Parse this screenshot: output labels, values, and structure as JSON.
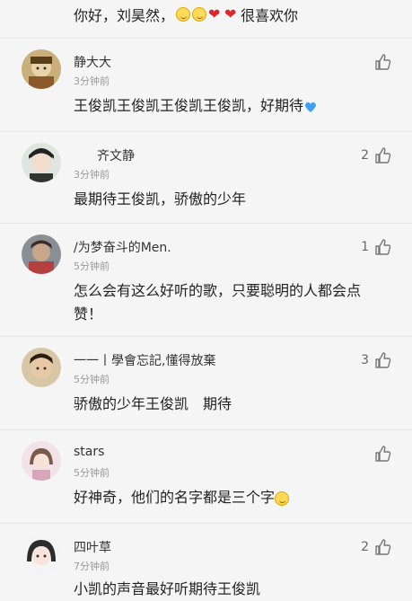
{
  "top": {
    "text_prefix": "你好，刘昊然，",
    "text_suffix": "很喜欢你"
  },
  "comments": [
    {
      "name": "静大大",
      "time": "3分钟前",
      "likes": "",
      "content": "王俊凯王俊凯王俊凯王俊凯，好期待",
      "content_emoji": "blue-heart-icon"
    },
    {
      "name": "齐文静",
      "time": "3分钟前",
      "likes": "2",
      "content": "最期待王俊凯，骄傲的少年"
    },
    {
      "name": "/为梦奋斗的Men.",
      "time": "5分钟前",
      "likes": "1",
      "content": "怎么会有这么好听的歌，只要聪明的人都会点赞！"
    },
    {
      "name": "一一丨學會忘記,懂得放棄",
      "time": "5分钟前",
      "likes": "3",
      "content": "骄傲的少年王俊凯　期待"
    },
    {
      "name": "stars",
      "time": "5分钟前",
      "likes": "",
      "content": "好神奇，他们的名字都是三个字",
      "content_emoji": "laughing-face-icon"
    },
    {
      "name": "四叶草",
      "time": "7分钟前",
      "likes": "2",
      "content": "小凯的声音最好听期待王俊凯"
    }
  ],
  "colors": {
    "divider": "#e4e4e4",
    "time": "#999999",
    "like_icon": "#777777",
    "heart_red": "#e0262b",
    "heart_blue": "#3ea0f0"
  }
}
